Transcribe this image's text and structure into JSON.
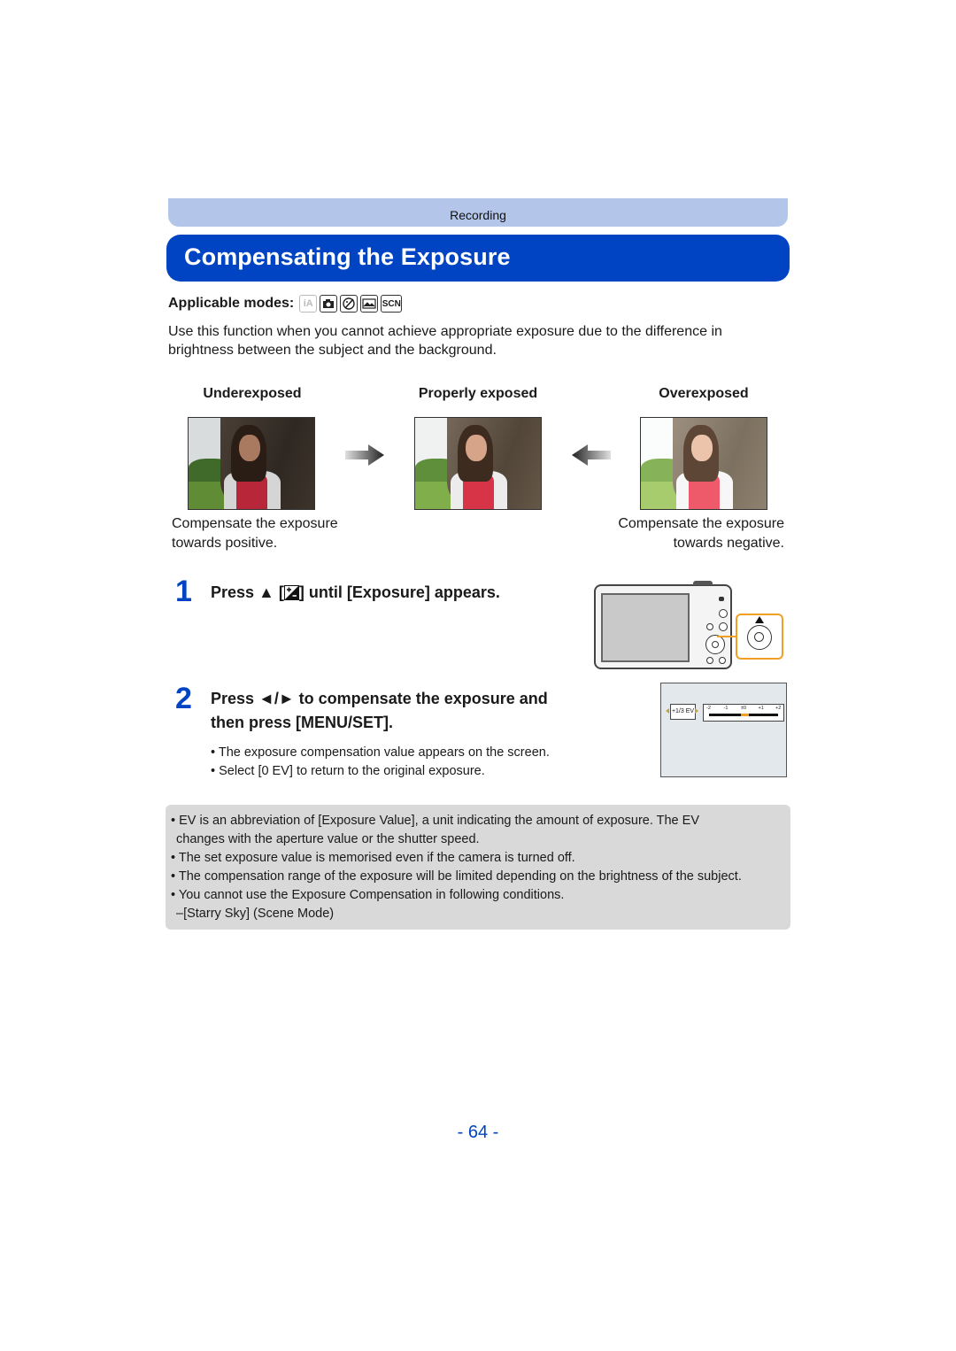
{
  "header": {
    "section": "Recording",
    "title": "Compensating the Exposure"
  },
  "applicable_modes": {
    "label": "Applicable modes:",
    "modes": [
      {
        "name": "intelligent-auto-mode-icon",
        "glyph": "iA",
        "available": false
      },
      {
        "name": "normal-picture-mode-icon",
        "glyph": "",
        "available": true
      },
      {
        "name": "creative-control-mode-icon",
        "glyph": "",
        "available": true
      },
      {
        "name": "panorama-mode-icon",
        "glyph": "",
        "available": true
      },
      {
        "name": "scene-mode-icon",
        "glyph": "SCN",
        "available": true
      }
    ]
  },
  "intro": "Use this function when you cannot achieve appropriate exposure due to the difference in brightness between the subject and the background.",
  "examples": {
    "columns": [
      {
        "heading": "Underexposed",
        "caption": [
          "Compensate the exposure",
          "towards positive."
        ],
        "brightness": "dark"
      },
      {
        "heading": "Properly exposed",
        "caption": [],
        "brightness": "normal"
      },
      {
        "heading": "Overexposed",
        "caption": [
          "Compensate the exposure",
          "towards negative."
        ],
        "brightness": "bright"
      }
    ],
    "arrow_right": "arrow-right-icon",
    "arrow_left": "arrow-left-icon"
  },
  "steps": [
    {
      "number": "1",
      "text_pre": "Press ▲ [",
      "text_post": "] until [Exposure] appears.",
      "icon": "exposure-compensation-icon"
    },
    {
      "number": "2",
      "line1": "Press ◄/► to compensate the exposure and",
      "line2": "then press [MENU/SET].",
      "bullets": [
        "The exposure compensation value appears on the screen.",
        "Select [0 EV] to return to the original exposure."
      ]
    }
  ],
  "screen_display": {
    "value_prefix": "+",
    "value_fraction": "1/3",
    "value_unit": "EV",
    "scale_labels": [
      "-2",
      "-1",
      "±0",
      "+1",
      "+2"
    ],
    "current_ev": 0.333
  },
  "notes": [
    {
      "bullet": "•",
      "text": "EV is an abbreviation of [Exposure Value], a unit indicating the amount of exposure. The EV"
    },
    {
      "bullet": "",
      "text": "changes with the aperture value or the shutter speed."
    },
    {
      "bullet": "•",
      "text": "The set exposure value is memorised even if the camera is turned off."
    },
    {
      "bullet": "•",
      "text": "The compensation range of the exposure will be limited depending on the brightness of the subject."
    },
    {
      "bullet": "•",
      "text": "You cannot use the Exposure Compensation in following conditions."
    },
    {
      "bullet": "–",
      "text": "[Starry Sky] (Scene Mode)"
    }
  ],
  "colors": {
    "brand_blue": "#0044c3",
    "section_bar": "#b3c6ea",
    "callout_orange": "#f2a024",
    "notes_bg": "#d9d9d9"
  },
  "page_number": "- 64 -"
}
